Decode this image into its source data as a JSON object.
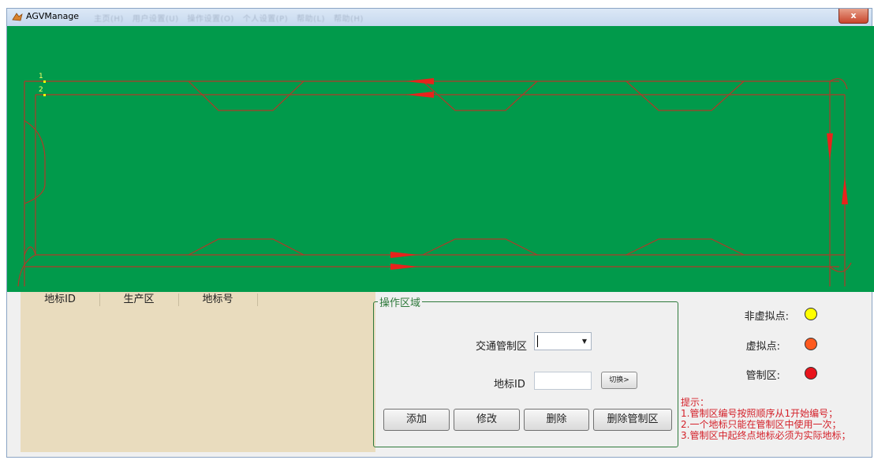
{
  "window": {
    "title": "AGVManage",
    "menu_items": [
      "主页(H)",
      "用户设置(U)",
      "操作设置(O)",
      "个人设置(P)",
      "帮助(L)",
      "帮助(H)"
    ],
    "close_label": "x"
  },
  "map": {
    "background_color": "#019a4b",
    "track_color": "#b03a28",
    "arrow_color": "#e8231c",
    "points": [
      {
        "label": "1"
      },
      {
        "label": "2"
      }
    ]
  },
  "grid": {
    "columns": [
      "地标ID",
      "生产区",
      "地标号"
    ],
    "rows": []
  },
  "operation": {
    "group_title": "操作区域",
    "traffic_zone_label": "交通管制区",
    "traffic_zone_value": "",
    "landmark_label": "地标ID",
    "landmark_value": "",
    "switch_label": "切换>",
    "buttons": {
      "add": "添加",
      "edit": "修改",
      "delete": "删除",
      "delete_zone": "删除管制区"
    }
  },
  "legend": [
    {
      "label": "非虚拟点:",
      "color": "#ffff00"
    },
    {
      "label": "虚拟点:",
      "color": "#ff5a1f"
    },
    {
      "label": "管制区:",
      "color": "#e8141c"
    }
  ],
  "tips": {
    "title": "提示：",
    "lines": [
      "1.管制区编号按照顺序从1开始编号；",
      "2.一个地标只能在管制区中使用一次；",
      "3.管制区中起终点地标必须为实际地标；"
    ]
  }
}
